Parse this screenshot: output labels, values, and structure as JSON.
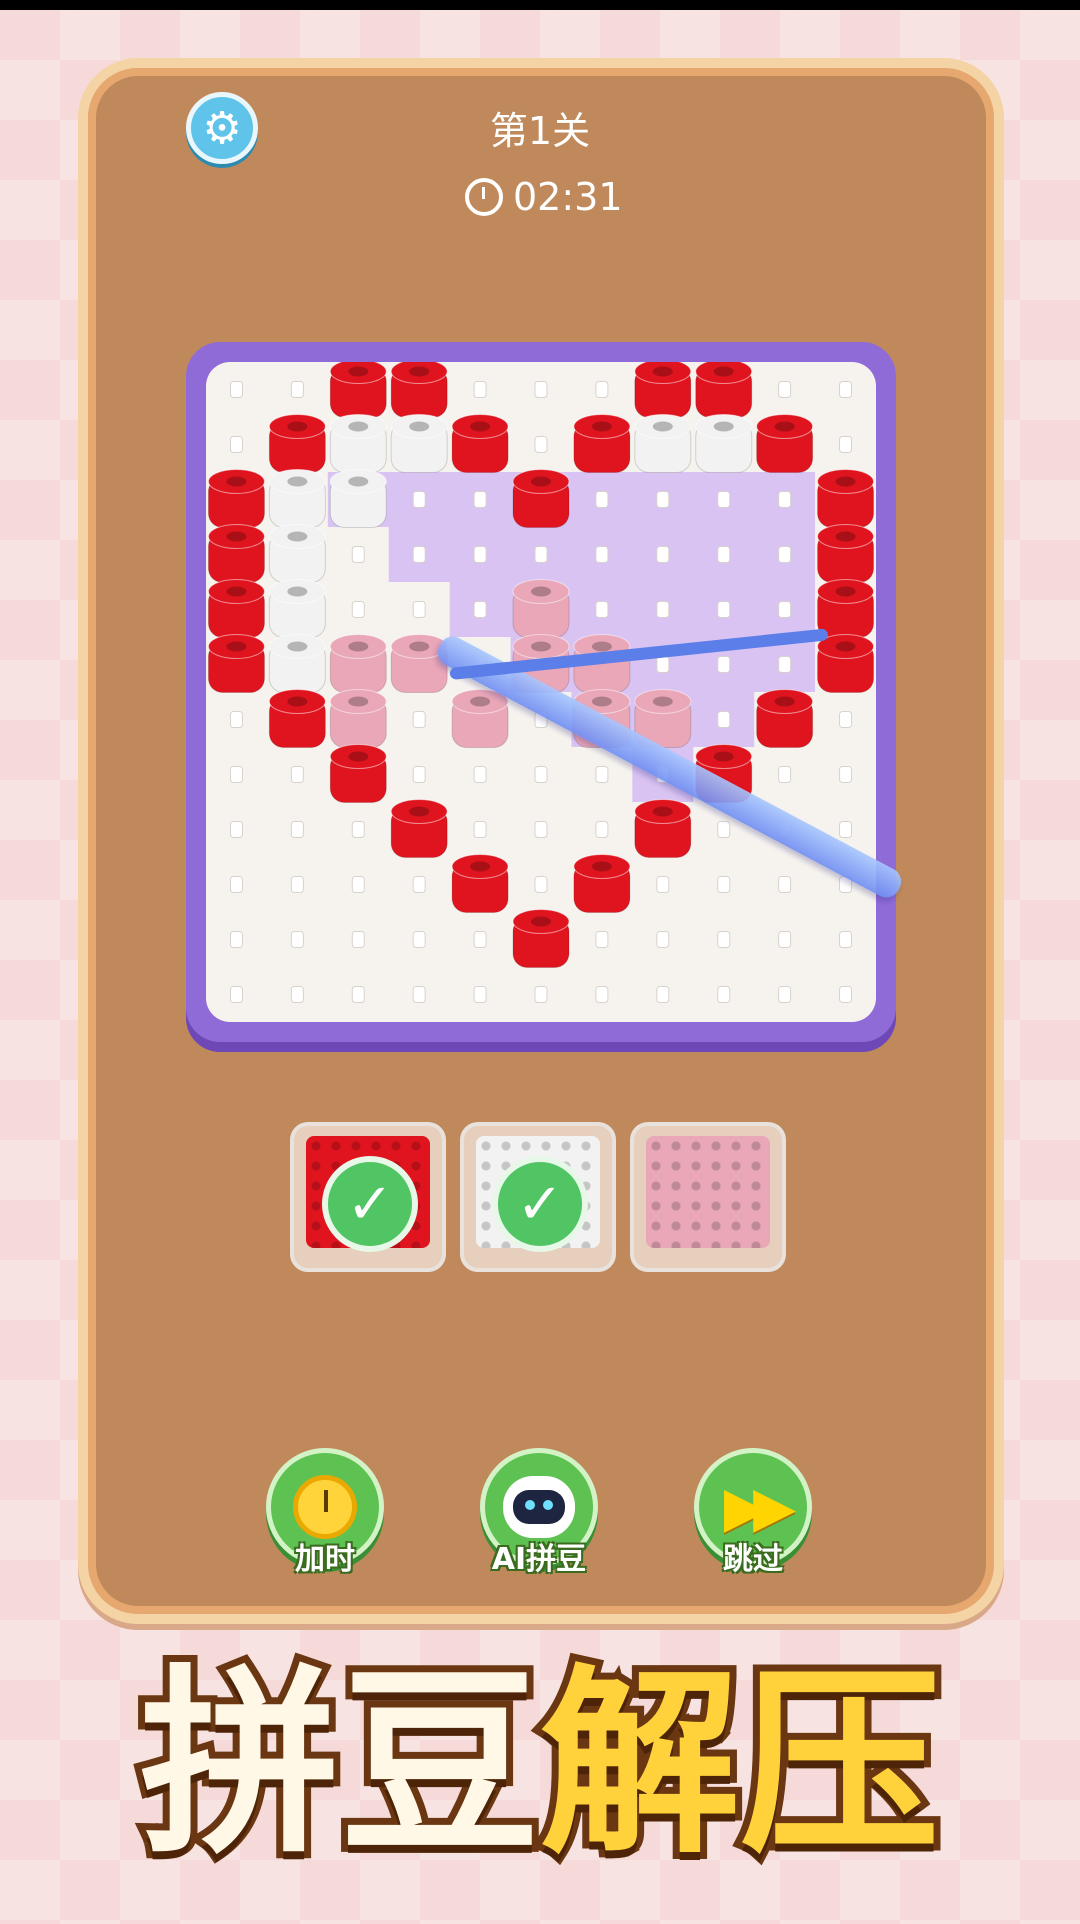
{
  "header": {
    "level_title": "第1关",
    "timer": "02:31",
    "settings_icon": "gear-icon",
    "timer_icon": "alarm-clock-icon"
  },
  "board": {
    "rows": 12,
    "cols": 11,
    "cells": [
      "..RR...RR..",
      ".RWWR.RWWR.",
      "RWW..R....R",
      "RW........R",
      "RW...P....R",
      "RWPP.PP...R",
      ".RP.P.PP.R.",
      "..R.....R..",
      "...R...R...",
      "....R.R....",
      ".....R.....",
      "..........."
    ],
    "heart_shade": "#d9c3f2",
    "colors": {
      "R": "#e0141e",
      "W": "#f2f2f2",
      "P": "#e9a7b8"
    }
  },
  "trays": [
    {
      "color": "#e0141e",
      "completed": true,
      "icon": "check-icon"
    },
    {
      "color": "#f2f2f2",
      "completed": true,
      "icon": "check-icon"
    },
    {
      "color": "#e9a7b8",
      "completed": false,
      "icon": ""
    }
  ],
  "tools": [
    {
      "label": "加时",
      "icon": "stopwatch-icon"
    },
    {
      "label": "AI拼豆",
      "icon": "robot-icon"
    },
    {
      "label": "跳过",
      "icon": "fast-forward-icon"
    }
  ],
  "banner": {
    "part1": "拼豆",
    "part2": "解压",
    "part1_color": "#fff8e6",
    "part2_color": "#ffd23c"
  }
}
